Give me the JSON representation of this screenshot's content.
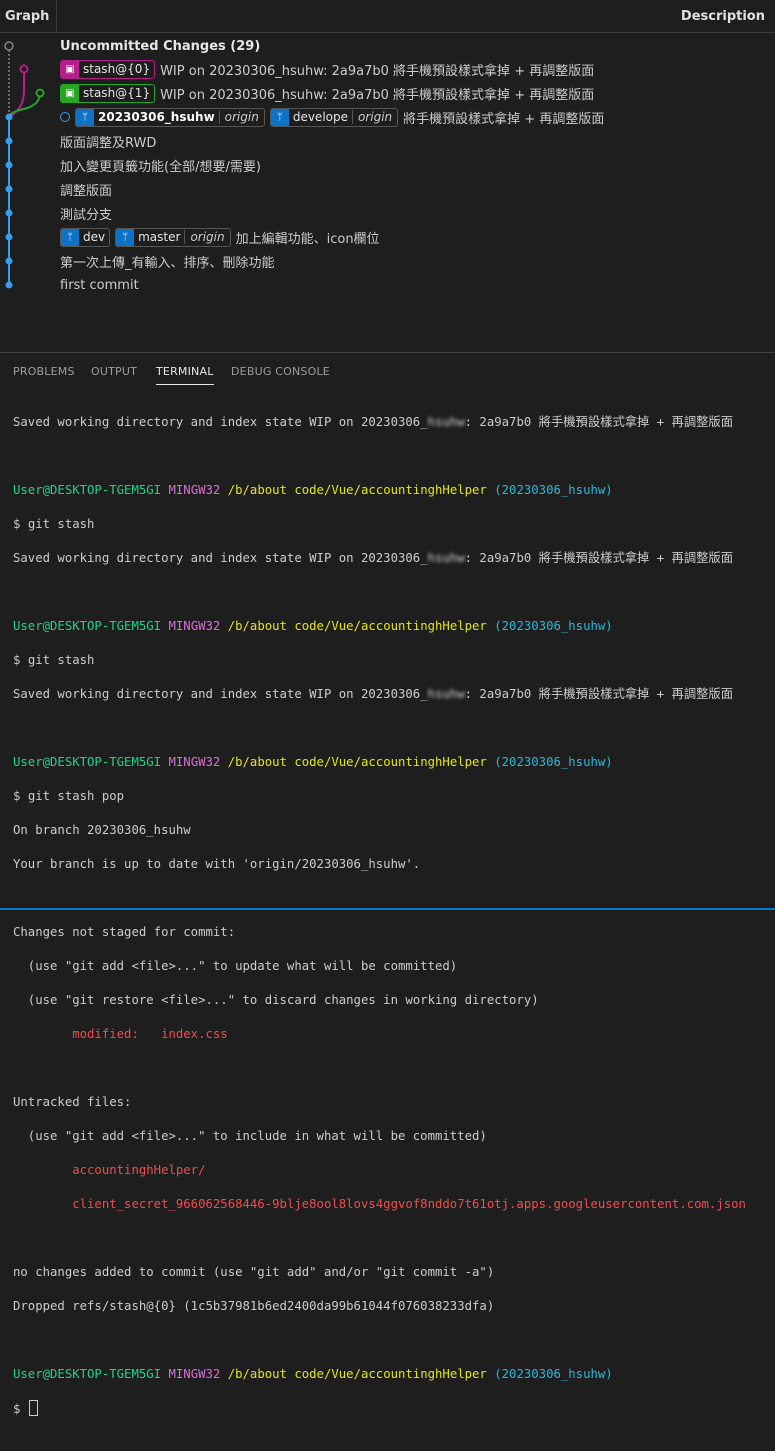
{
  "graph_header": {
    "graph": "Graph",
    "description": "Description"
  },
  "commits": {
    "uncommitted": "Uncommitted Changes (29)",
    "stash0": {
      "ref": "stash@{0}",
      "message": "WIP on 20230306_hsuhw: 2a9a7b0 將手機預設樣式拿掉 + 再調整版面"
    },
    "stash1": {
      "ref": "stash@{1}",
      "message": "WIP on 20230306_hsuhw: 2a9a7b0 將手機預設樣式拿掉 + 再調整版面"
    },
    "head": {
      "branch": "20230306_hsuhw",
      "origin": "origin",
      "branch2": "develope",
      "origin2": "origin",
      "message": "將手機預設樣式拿掉 + 再調整版面"
    },
    "c4": "版面調整及RWD",
    "c5": "加入變更頁籤功能(全部/想要/需要)",
    "c6": "調整版面",
    "c7": "測試分支",
    "c8": {
      "branch": "dev",
      "branch2": "master",
      "origin2": "origin",
      "message": "加上編輯功能、icon欄位"
    },
    "c9": "第一次上傳_有輸入、排序、刪除功能",
    "c10": "first commit"
  },
  "tabs": [
    "PROBLEMS",
    "OUTPUT",
    "TERMINAL",
    "DEBUG CONSOLE"
  ],
  "terminal": {
    "saved1": "Saved working directory and index state WIP on 20230306_hsuhw: 2a9a7b0 將手機預設樣式拿掉 + 再調整版面",
    "user": "User@DESKTOP-TGEM5GI",
    "shell": "MINGW32",
    "path": "/b/about code/Vue/accountinghHelper",
    "branch": "(20230306_hsuhw)",
    "prompt": "$",
    "cmd_stash": "git stash",
    "saved_prefix": "Saved working directory and index state WIP on 20230306_",
    "blur_text": "hsuhw",
    "saved_suffix": ": 2a9a7b0 將手機預設樣式拿掉 + 再調整版面",
    "cmd_pop": "git stash pop",
    "on_branch": "On branch 20230306_hsuhw",
    "up_to_date": "Your branch is up to date with 'origin/20230306_hsuhw'.",
    "changes_not_staged": "Changes not staged for commit:",
    "hint_add": "  (use \"git add <file>...\" to update what will be committed)",
    "hint_restore": "  (use \"git restore <file>...\" to discard changes in working directory)",
    "modified": "        modified:   index.css",
    "untracked": "Untracked files:",
    "hint_untracked": "  (use \"git add <file>...\" to include in what will be committed)",
    "file1": "        accountinghHelper/",
    "file2": "        client_secret_966062568446-9blje8ool8lovs4ggvof8nddo7t61otj.apps.googleusercontent.com.json",
    "no_changes": "no changes added to commit (use \"git add\" and/or \"git commit -a\")",
    "dropped": "Dropped refs/stash@{0} (1c5b37981b6ed2400da99b61044f076038233dfa)"
  },
  "colors": {
    "stash0": "#b61e8e",
    "stash1": "#27a623",
    "branch": "#0e72c6",
    "graph_line": "#3b9ee8"
  }
}
